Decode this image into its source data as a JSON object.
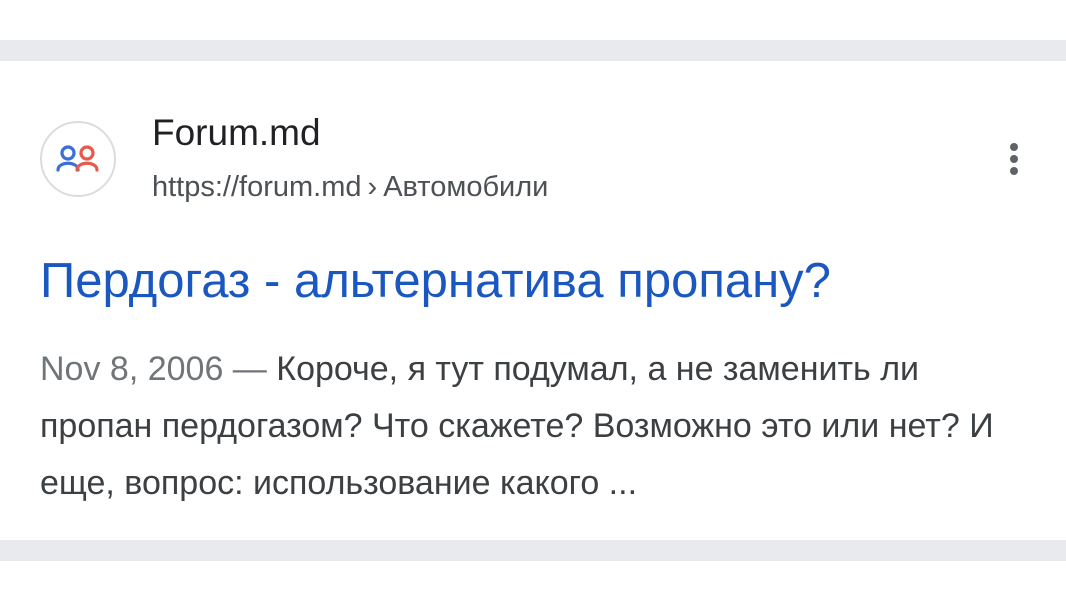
{
  "result": {
    "site_name": "Forum.md",
    "url": "https://forum.md",
    "url_separator": "›",
    "breadcrumb": "Автомобили",
    "title": "Пердогаз - альтернатива пропану?",
    "date": "Nov 8, 2006",
    "date_separator": " — ",
    "snippet": "Короче, я тут подумал, а не заменить ли пропан пердогазом? Что скажете? Возможно это или нет? И еще, вопрос: использование какого ..."
  },
  "icons": {
    "favicon": "forum-md-people-icon",
    "menu": "more-vert-icon"
  },
  "colors": {
    "title_link": "#1a57c0",
    "favicon_left_person": "#3b6fd6",
    "favicon_right_person": "#e8584c",
    "divider": "#e8eaed"
  }
}
